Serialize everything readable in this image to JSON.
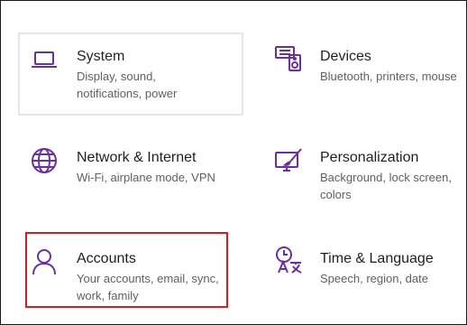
{
  "settings_tiles": [
    {
      "title": "System",
      "desc_lines": [
        "Display, sound,",
        "notifications, power"
      ],
      "icon": "laptop-icon"
    },
    {
      "title": "Devices",
      "desc_lines": [
        "Bluetooth, printers, mouse"
      ],
      "icon": "devices-icon"
    },
    {
      "title": "Network & Internet",
      "desc_lines": [
        "Wi-Fi, airplane mode, VPN"
      ],
      "icon": "globe-icon"
    },
    {
      "title": "Personalization",
      "desc_lines": [
        "Background, lock screen,",
        "colors"
      ],
      "icon": "personalization-icon"
    },
    {
      "title": "Accounts",
      "desc_lines": [
        "Your accounts, email, sync,",
        "work, family"
      ],
      "icon": "person-icon"
    },
    {
      "title": "Time & Language",
      "desc_lines": [
        "Speech, region, date"
      ],
      "icon": "time-language-icon"
    }
  ],
  "colors": {
    "accent": "#6b2fa0",
    "highlight": "#d11f1f",
    "tile_outline": "#e5e5e5"
  }
}
